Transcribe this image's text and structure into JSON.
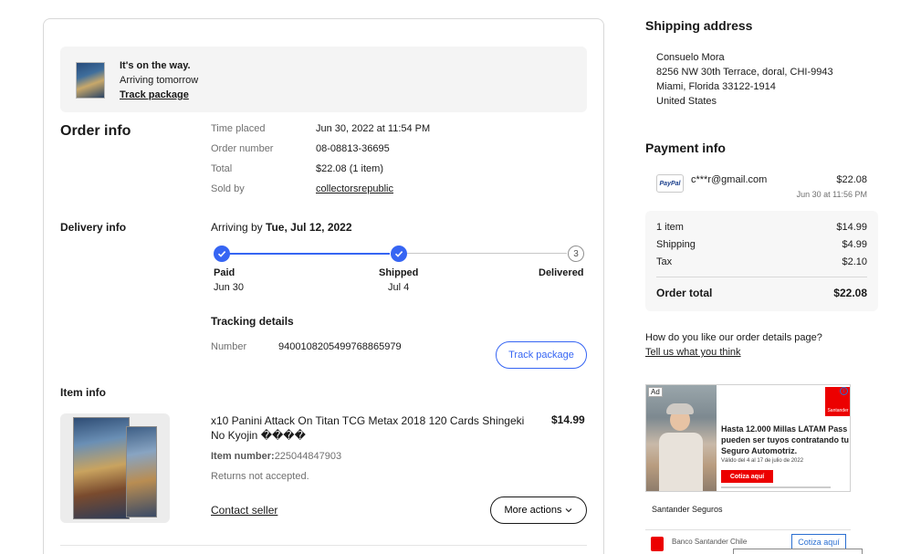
{
  "notice": {
    "title": "It's on the way.",
    "subtitle": "Arriving tomorrow",
    "link": "Track package"
  },
  "order_info": {
    "heading": "Order info",
    "rows": [
      {
        "label": "Time placed",
        "value": "Jun 30, 2022 at 11:54 PM"
      },
      {
        "label": "Order number",
        "value": "08-08813-36695"
      },
      {
        "label": "Total",
        "value": "$22.08 (1 item)"
      },
      {
        "label": "Sold by",
        "value": "collectorsrepublic"
      }
    ]
  },
  "delivery": {
    "heading": "Delivery info",
    "arriving_prefix": "Arriving by",
    "arriving_date": "Tue, Jul 12, 2022",
    "steps": [
      {
        "label": "Paid",
        "date": "Jun 30",
        "status": "done"
      },
      {
        "label": "Shipped",
        "date": "Jul 4",
        "status": "done"
      },
      {
        "label": "Delivered",
        "date": "",
        "status": "pending",
        "number": "3"
      }
    ],
    "tracking_heading": "Tracking details",
    "tracking_label": "Number",
    "tracking_number": "9400108205499768865979",
    "track_button": "Track package"
  },
  "item": {
    "heading": "Item info",
    "title": "x10 Panini Attack On Titan TCG Metax 2018 120 Cards Shingeki No Kyojin ����",
    "price": "$14.99",
    "number_label": "Item number:",
    "number": "225044847903",
    "returns": "Returns not accepted.",
    "contact": "Contact seller",
    "more_actions": "More actions"
  },
  "shipping": {
    "heading": "Shipping address",
    "lines": [
      "Consuelo Mora",
      "8256 NW 30th Terrace, doral, CHI-9943",
      "Miami, Florida 33122-1914",
      "United States"
    ]
  },
  "payment": {
    "heading": "Payment info",
    "method": "PayPal",
    "email": "c***r@gmail.com",
    "amount": "$22.08",
    "date": "Jun 30 at 11:56 PM",
    "summary": [
      {
        "label": "1 item",
        "value": "$14.99"
      },
      {
        "label": "Shipping",
        "value": "$4.99"
      },
      {
        "label": "Tax",
        "value": "$2.10"
      }
    ],
    "total_label": "Order total",
    "total_value": "$22.08"
  },
  "feedback": {
    "question": "How do you like our order details page?",
    "link": "Tell us what you think"
  },
  "ad": {
    "badge": "Ad",
    "logo_text": "Santander",
    "headline": "Hasta 12.000 Millas LATAM Pass pueden ser tuyos contratando tu Seguro Automotriz.",
    "validity": "Válido del 4 al 17 de julio de 2022",
    "cta": "Cotiza aquí",
    "brand": "Santander Seguros",
    "bank": "Banco Santander Chile",
    "bank_button": "Cotiza aquí"
  },
  "colors": {
    "accent": "#3665f3",
    "santander_red": "#ec0000"
  }
}
